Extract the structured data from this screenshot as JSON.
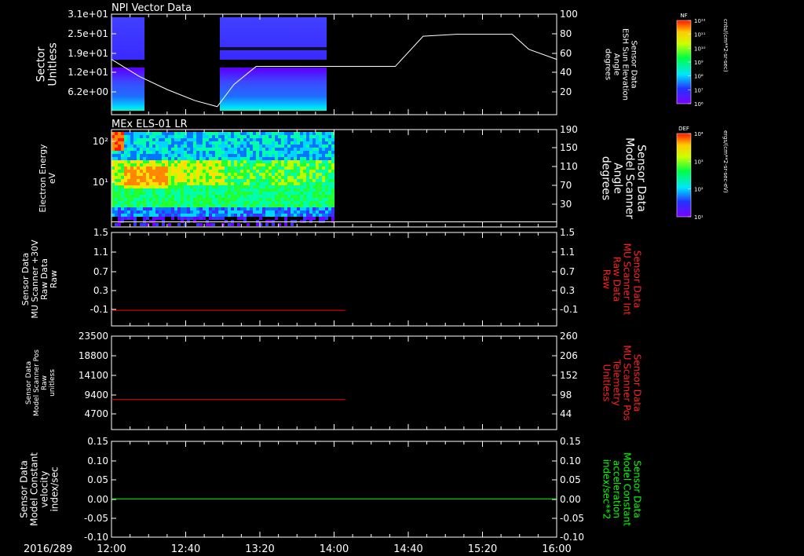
{
  "date_label": "2016/289",
  "time_ticks": [
    "12:00",
    "12:40",
    "13:20",
    "14:00",
    "14:40",
    "15:20",
    "16:00"
  ],
  "colors": {
    "background": "#000000",
    "axis": "#ffffff",
    "red_trace": "#ff0000",
    "green_trace": "#00ff00"
  },
  "colorbars": [
    {
      "title": "NF",
      "unit": "cnts/(cm**2-sr-sec)",
      "ticks": [
        "10¹²",
        "10¹¹",
        "10¹⁰",
        "10⁹",
        "10⁸",
        "10⁷",
        "10⁶"
      ]
    },
    {
      "title": "DEF",
      "unit": "ergs/(cm**2-sr-sec-eV)",
      "ticks": [
        "10⁴",
        "10³",
        "10²",
        "10¹"
      ]
    }
  ],
  "chart_data": [
    {
      "type": "heatmap",
      "title": "NPI Vector Data",
      "ylabel_left": [
        "Sector",
        "Unitless"
      ],
      "yticks_left": [
        "3.1e+01",
        "2.5e+01",
        "1.9e+01",
        "1.2e+01",
        "6.2e+00"
      ],
      "ylabel_right": [
        "Sensor Data",
        "ESH Sun Elevation",
        "Angle",
        "degrees"
      ],
      "yticks_right": [
        "100",
        "80",
        "60",
        "40",
        "20"
      ],
      "ylim_right": [
        0,
        100
      ],
      "data_coverage_hours": [
        [
          12.0,
          12.55
        ],
        [
          12.92,
          14.0
        ]
      ],
      "overlay_line": {
        "name": "ESH Sun Elevation",
        "x": [
          12.0,
          12.25,
          12.5,
          12.75,
          12.95,
          13.1,
          13.3,
          13.6,
          13.95,
          14.3,
          14.55,
          14.8,
          15.1,
          15.4,
          15.6,
          15.75,
          16.0
        ],
        "y": [
          55,
          38,
          25,
          14,
          8,
          30,
          48,
          48,
          48,
          48,
          48,
          78,
          80,
          80,
          80,
          65,
          55
        ]
      }
    },
    {
      "type": "heatmap",
      "title": "MEx ELS-01 LR",
      "ylabel_left": [
        "Electron Energy",
        "eV"
      ],
      "yticks_left": [
        "10²",
        "10¹"
      ],
      "ylabel_right": [
        "Sensor Data",
        "Model Scanner",
        "Angle",
        "degrees"
      ],
      "yticks_right": [
        "190",
        "150",
        "110",
        "70",
        "30"
      ],
      "ylim_right": [
        0,
        190
      ],
      "data_coverage_hours": [
        [
          12.0,
          14.0
        ]
      ],
      "overlay_line": {
        "name": "Model Scanner Angle",
        "x": [
          12.0,
          16.0
        ],
        "y": [
          10,
          10
        ]
      }
    },
    {
      "type": "line",
      "ylabel_left": [
        "Sensor Data",
        "MU Scanner +30V",
        "Raw Data",
        "Raw"
      ],
      "yticks_left": [
        "1.5",
        "1.1",
        "0.7",
        "0.3",
        "-0.1"
      ],
      "ylim_left": [
        -0.3,
        1.5
      ],
      "ylabel_right": [
        "Sensor Data",
        "MU Scanner Int",
        "Raw Data",
        "Raw"
      ],
      "yticks_right": [
        "1.5",
        "1.1",
        "0.7",
        "0.3",
        "-0.1"
      ],
      "series": [
        {
          "color": "#ff0000",
          "x": [
            12.0,
            14.1
          ],
          "y": [
            0.0,
            0.0
          ]
        }
      ]
    },
    {
      "type": "line",
      "ylabel_left": [
        "Sensor Data",
        "Model Scanner Pos",
        "Raw",
        "unitless"
      ],
      "yticks_left": [
        "23500",
        "18800",
        "14100",
        "9400",
        "4700"
      ],
      "ylim_left": [
        0,
        23500
      ],
      "ylabel_right": [
        "Sensor Data",
        "MU Scanner Pos",
        "Telemetry",
        "Unitless"
      ],
      "yticks_right": [
        "260",
        "206",
        "152",
        "98",
        "44"
      ],
      "series": [
        {
          "color": "#ff0000",
          "x": [
            12.0,
            14.1
          ],
          "y": [
            7550,
            7550
          ]
        }
      ]
    },
    {
      "type": "line",
      "ylabel_left": [
        "Sensor Data",
        "Model Constant",
        "velocity",
        "index/sec"
      ],
      "yticks_left": [
        "0.15",
        "0.10",
        "0.05",
        "0.00",
        "-0.05",
        "-0.10"
      ],
      "ylim_left": [
        -0.1,
        0.15
      ],
      "ylabel_right": [
        "Sensor Data",
        "Model Constant",
        "acceleration",
        "index/sec**2"
      ],
      "yticks_right": [
        "0.15",
        "0.10",
        "0.05",
        "0.00",
        "-0.05",
        "-0.10"
      ],
      "series": [
        {
          "color": "#00ff00",
          "x": [
            12.0,
            16.0
          ],
          "y": [
            0.0,
            0.0
          ]
        }
      ]
    }
  ]
}
